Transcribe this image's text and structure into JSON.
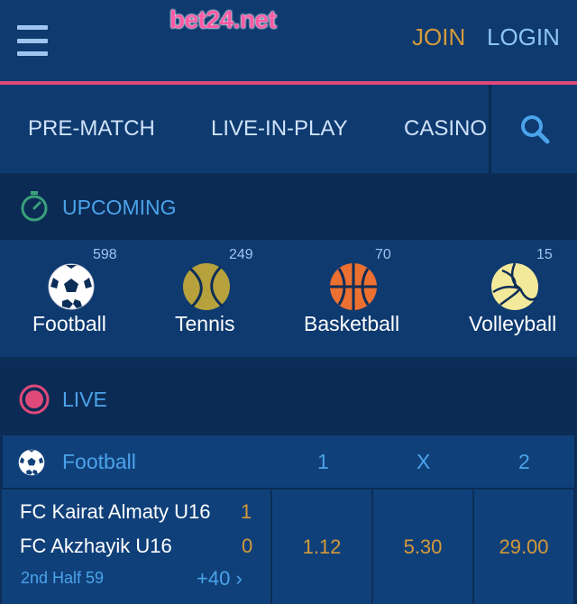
{
  "header": {
    "logo_text": "bet24.net",
    "join_label": "JOIN",
    "login_label": "LOGIN"
  },
  "nav": {
    "tabs": [
      {
        "label": "PRE-MATCH"
      },
      {
        "label": "LIVE-IN-PLAY"
      },
      {
        "label": "CASINO"
      }
    ]
  },
  "upcoming": {
    "title": "UPCOMING",
    "sports": [
      {
        "name": "Football",
        "count": "598",
        "icon": "football-icon"
      },
      {
        "name": "Tennis",
        "count": "249",
        "icon": "tennis-ball-icon"
      },
      {
        "name": "Basketball",
        "count": "70",
        "icon": "basketball-icon"
      },
      {
        "name": "Volleyball",
        "count": "15",
        "icon": "volleyball-icon"
      }
    ]
  },
  "live": {
    "title": "LIVE",
    "sport": "Football",
    "columns": [
      "1",
      "X",
      "2"
    ],
    "match": {
      "home_team": "FC Kairat Almaty U16",
      "home_score": "1",
      "away_team": "FC Akzhayik U16",
      "away_score": "0",
      "period": "2nd Half 59",
      "more_markets": "+40",
      "odds": [
        "1.12",
        "5.30",
        "29.00"
      ]
    }
  },
  "colors": {
    "background": "#0c2d57",
    "panel": "#0e3a70",
    "accent_blue": "#4ba3ea",
    "accent_gold": "#d49a3a",
    "accent_pink": "#e0497a"
  }
}
